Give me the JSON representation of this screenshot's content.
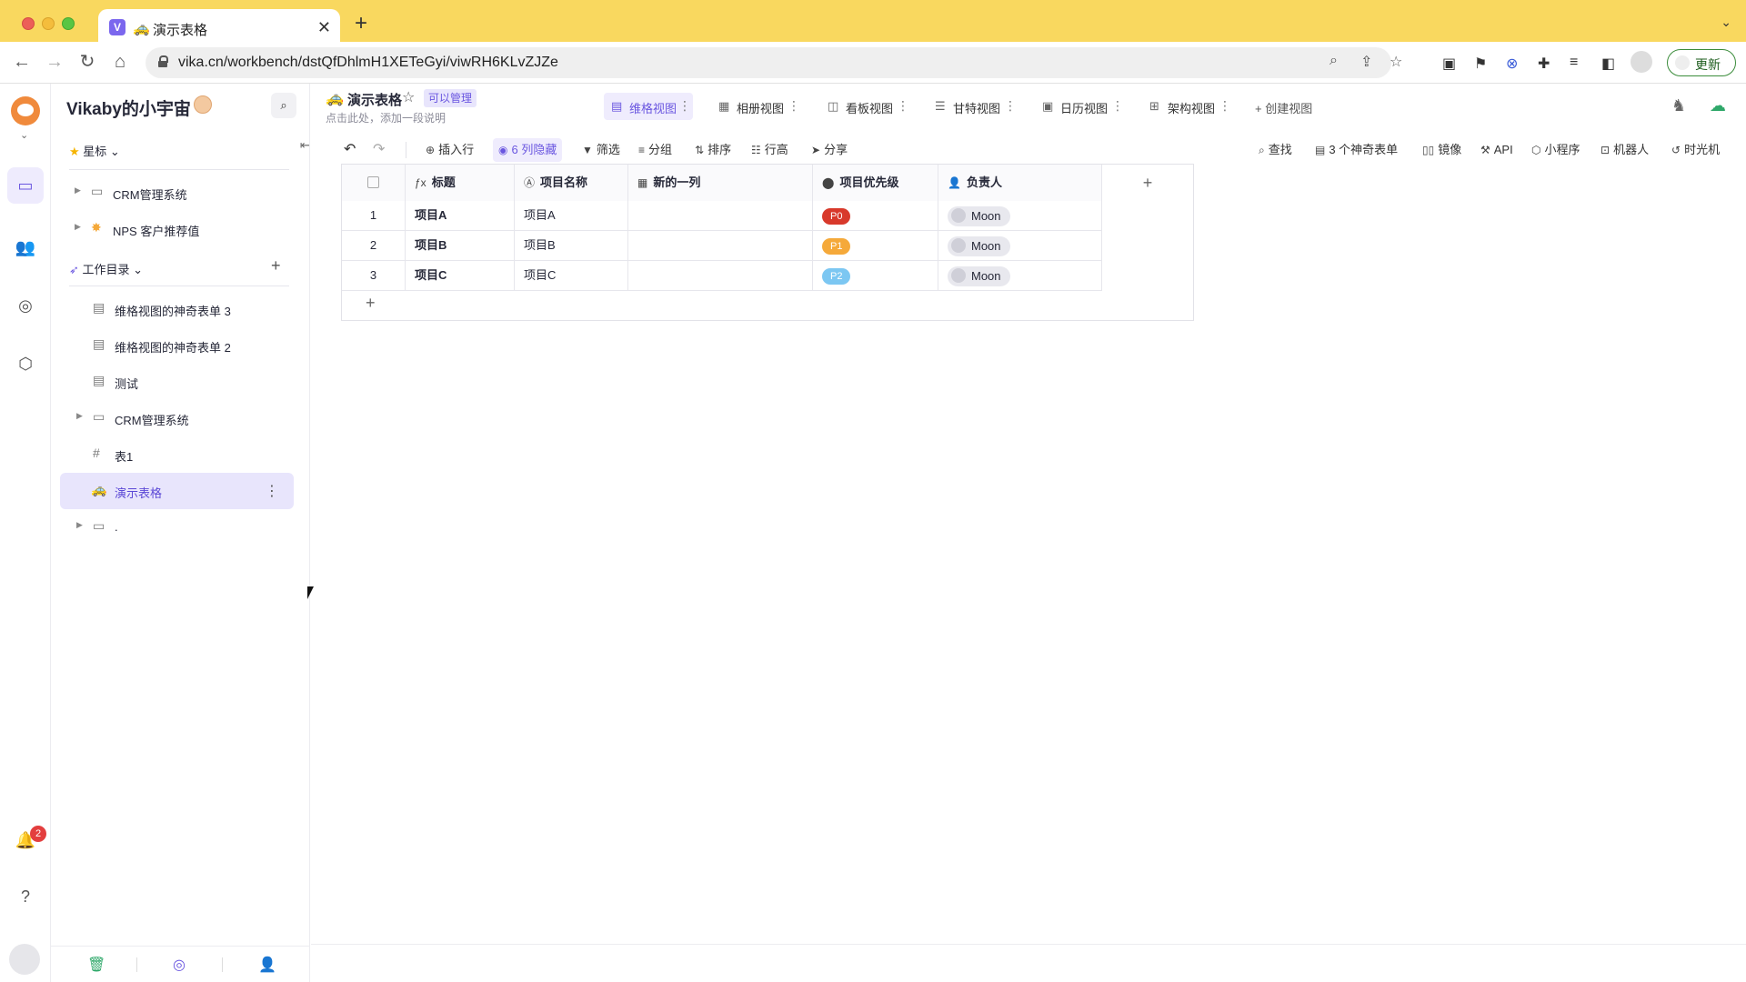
{
  "browser": {
    "tab_emoji": "🚕",
    "tab_title": "演示表格",
    "url": "vika.cn/workbench/dstQfDhlmH1XETeGyi/viwRH6KLvZJZe",
    "update_label": "更新"
  },
  "leftnav": {
    "notification_count": "2"
  },
  "sidebar": {
    "space_name": "Vikaby的小宇宙",
    "starred_label": "星标",
    "workspace_label": "工作目录",
    "starred_items": [
      {
        "label": "CRM管理系统"
      },
      {
        "label": "NPS 客户推荐值"
      }
    ],
    "items": [
      {
        "label": "维格视图的神奇表单 3"
      },
      {
        "label": "维格视图的神奇表单 2"
      },
      {
        "label": "测试"
      },
      {
        "label": "CRM管理系统"
      },
      {
        "label": "表1"
      },
      {
        "label": "演示表格",
        "emoji": "🚕"
      },
      {
        "label": "."
      }
    ]
  },
  "sheet": {
    "emoji": "🚕",
    "name": "演示表格",
    "permission": "可以管理",
    "description": "点击此处，添加一段说明"
  },
  "views": [
    {
      "label": "维格视图",
      "icon": "grid-view-icon"
    },
    {
      "label": "相册视图",
      "icon": "gallery-view-icon"
    },
    {
      "label": "看板视图",
      "icon": "kanban-view-icon"
    },
    {
      "label": "甘特视图",
      "icon": "gantt-view-icon"
    },
    {
      "label": "日历视图",
      "icon": "calendar-view-icon"
    },
    {
      "label": "架构视图",
      "icon": "architecture-view-icon"
    }
  ],
  "add_view_label": "创建视图",
  "toolbar": {
    "insert_row": "插入行",
    "hidden_cols": "6 列隐藏",
    "filter": "筛选",
    "group": "分组",
    "sort": "排序",
    "row_height": "行高",
    "share": "分享",
    "find": "查找",
    "forms": "3 个神奇表单",
    "mirror": "镜像",
    "api": "API",
    "widget": "小程序",
    "robot": "机器人",
    "timemachine": "时光机"
  },
  "table": {
    "columns": [
      "标题",
      "项目名称",
      "新的一列",
      "项目优先级",
      "负责人"
    ],
    "rows": [
      {
        "num": "1",
        "title": "项目A",
        "name": "项目A",
        "newcol": "",
        "priority": "P0",
        "priority_color": "#d8392b",
        "owner": "Moon"
      },
      {
        "num": "2",
        "title": "项目B",
        "name": "项目B",
        "newcol": "",
        "priority": "P1",
        "priority_color": "#f5a93a",
        "owner": "Moon"
      },
      {
        "num": "3",
        "title": "项目C",
        "name": "项目C",
        "newcol": "",
        "priority": "P2",
        "priority_color": "#7cc7f2",
        "owner": "Moon"
      }
    ]
  },
  "colors": {
    "accent": "#7b67ee",
    "chrome_bar": "#f9d85f"
  }
}
